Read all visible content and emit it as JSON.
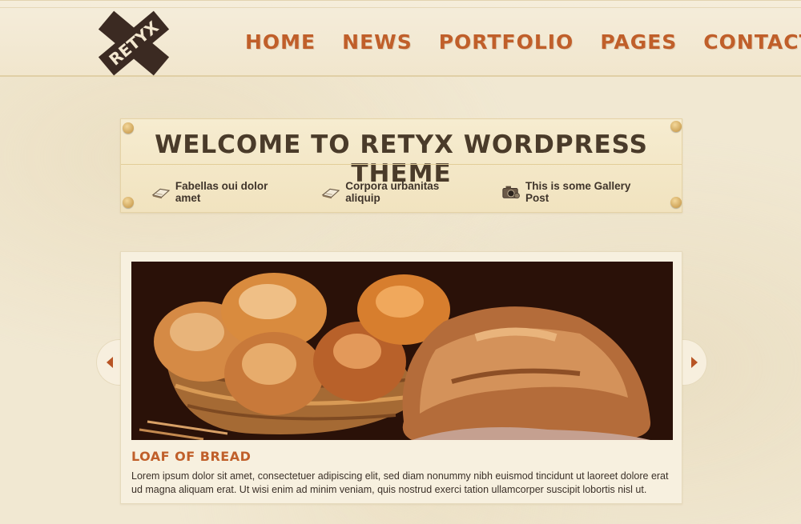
{
  "logo": {
    "text": "RETYX"
  },
  "nav": {
    "items": [
      "HOME",
      "NEWS",
      "PORTFOLIO",
      "PAGES",
      "CONTACT"
    ]
  },
  "welcome": {
    "title": "WELCOME TO RETYX WORDPRESS THEME",
    "posts": [
      {
        "label": "Fabellas oui dolor amet",
        "icon": "book-icon"
      },
      {
        "label": "Corpora urbanitas aliquip",
        "icon": "book-icon"
      },
      {
        "label": "This is some Gallery Post",
        "icon": "camera-icon"
      }
    ]
  },
  "slider": {
    "title": "LOAF OF BREAD",
    "text": "Lorem ipsum dolor sit amet, consectetuer adipiscing elit, sed diam nonummy nibh euismod tincidunt ut laoreet dolore erat ud magna aliquam erat. Ut wisi enim ad minim veniam, quis nostrud exerci tation ullamcorper suscipit lobortis nisl ut.",
    "prev_icon": "arrow-left-icon",
    "next_icon": "arrow-right-icon"
  },
  "colors": {
    "accent": "#c05f2a",
    "dark_text": "#4a3b2a",
    "background": "#f1e8d2"
  }
}
